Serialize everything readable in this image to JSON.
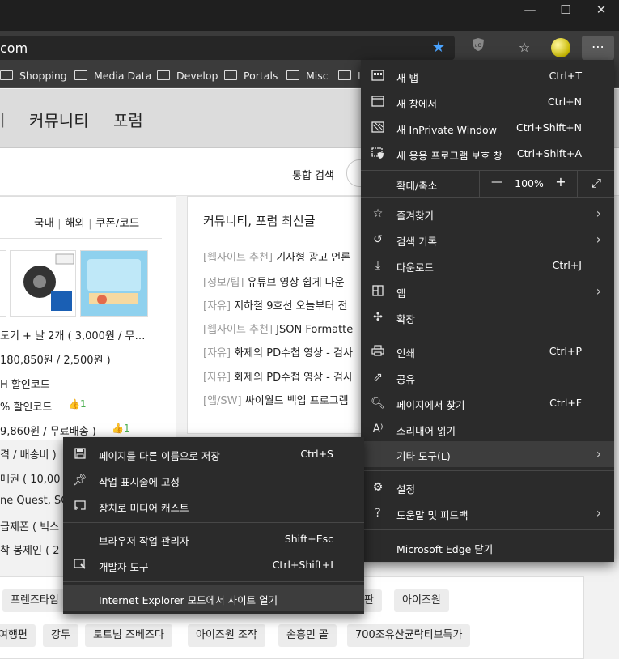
{
  "window": {
    "minimize": "—",
    "maximize": "☐",
    "close": "✕"
  },
  "address": {
    "url_visible": "om"
  },
  "bookmarks": [
    "Shopping",
    "Media Data",
    "Develop",
    "Portals",
    "Misc",
    "L"
  ],
  "nav": {
    "items": [
      "ㅣ",
      "커뮤니티",
      "포럼"
    ]
  },
  "search": {
    "label": "통합 검색"
  },
  "deals": {
    "tabs": [
      "국내",
      "해외",
      "쿠폰/코드"
    ],
    "lines": [
      "도기 + 날 2개 ( 3,000원 / 무…",
      "180,850원 / 2,500원 )",
      "H 할인코드",
      "% 할인코드",
      "9,860원 / 무료배송 )",
      "격 / 배송비 )",
      "매권 ( 10,00",
      "ne Quest, SC",
      "급제폰 ( 빅스",
      "착 봉제인 ( 2"
    ],
    "likes": [
      "1",
      "1"
    ]
  },
  "community": {
    "title": "커뮤니티, 포럼 최신글",
    "posts": [
      {
        "cat": "[웹사이트 추천]",
        "text": "기사형 광고 언론"
      },
      {
        "cat": "[정보/팁]",
        "text": "유튜브 영상 쉽게 다운"
      },
      {
        "cat": "[자유]",
        "text": "지하철 9호선 오늘부터 전"
      },
      {
        "cat": "[웹사이트 추천]",
        "text": "JSON Formatte"
      },
      {
        "cat": "[자유]",
        "text": "화제의 PD수첩 영상 - 검사"
      },
      {
        "cat": "[자유]",
        "text": "화제의 PD수첩 영상 - 검사"
      },
      {
        "cat": "[앱/SW]",
        "text": "싸이월드 백업 프로그램"
      }
    ]
  },
  "tags": {
    "row1": [
      "프렌즈타임",
      "평판",
      "아이즈원"
    ],
    "row2": [
      "여행편",
      "강두",
      "토트넘 즈베즈다",
      "아이즈원 조작",
      "손흥민 골",
      "700조유산균락티브특가"
    ]
  },
  "menu": {
    "new_tab": {
      "label": "새 탭",
      "shortcut": "Ctrl+T"
    },
    "new_window": {
      "label": "새 창에서",
      "shortcut": "Ctrl+N"
    },
    "new_inprivate": {
      "label": "새 InPrivate Window",
      "shortcut": "Ctrl+Shift+N"
    },
    "new_app_guard": {
      "label": "새 응용 프로그램 보호 창",
      "shortcut": "Ctrl+Shift+A"
    },
    "zoom": {
      "label": "확대/축소",
      "minus": "—",
      "value": "100%",
      "plus": "+"
    },
    "favorites": {
      "label": "즐겨찾기"
    },
    "history": {
      "label": "검색 기록"
    },
    "downloads": {
      "label": "다운로드",
      "shortcut": "Ctrl+J"
    },
    "apps": {
      "label": "앱"
    },
    "extensions": {
      "label": "확장"
    },
    "print": {
      "label": "인쇄",
      "shortcut": "Ctrl+P"
    },
    "share": {
      "label": "공유"
    },
    "find": {
      "label": "페이지에서 찾기",
      "shortcut": "Ctrl+F"
    },
    "read_aloud": {
      "label": "소리내어 읽기"
    },
    "more_tools": {
      "label": "기타 도구(L)"
    },
    "settings": {
      "label": "설정"
    },
    "help": {
      "label": "도움말 및 피드백"
    },
    "close_edge": {
      "label": "Microsoft Edge 닫기"
    }
  },
  "submenu": {
    "save_as": {
      "label": "페이지를 다른 이름으로 저장",
      "shortcut": "Ctrl+S"
    },
    "pin_taskbar": {
      "label": "작업 표시줄에 고정"
    },
    "cast": {
      "label": "장치로 미디어 캐스트"
    },
    "task_manager": {
      "label": "브라우저 작업 관리자",
      "shortcut": "Shift+Esc"
    },
    "dev_tools": {
      "label": "개발자 도구",
      "shortcut": "Ctrl+Shift+I"
    },
    "ie_mode": {
      "label": "Internet Explorer 모드에서 사이트 열기"
    }
  },
  "colors": {
    "menu_bg": "#2b2b2b",
    "hover": "#3d3d3d",
    "star": "#4aa3ff",
    "like": "#4caf50"
  }
}
